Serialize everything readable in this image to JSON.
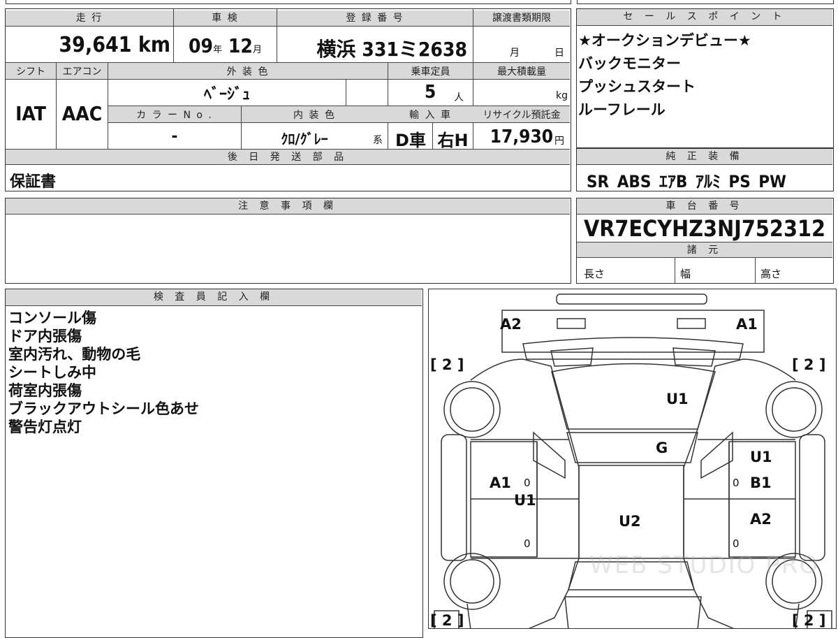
{
  "top_table": {
    "mileage_label": "走 行",
    "mileage_value": "39,641 km",
    "inspection_label": "車 検",
    "inspection_year": "09",
    "inspection_month": "12",
    "unit_year": "年",
    "unit_month": "月",
    "registration_label": "登 録 番 号",
    "registration_value": "横浜 331ミ2638",
    "transfer_label": "譲渡書類期限",
    "transfer_month": "月",
    "transfer_day": "日",
    "shift_label": "シフト",
    "ac_label": "エアコン",
    "ext_color_label": "外 装 色",
    "capacity_label": "乗車定員",
    "max_load_label": "最大積載量",
    "shift_value": "IAT",
    "ac_value": "AAC",
    "ext_color_value": "ﾍﾞｰｼﾞｭ",
    "capacity_value": "5",
    "capacity_unit": "人",
    "load_unit": "kg",
    "color_no_label": "カ ラ ー N o .",
    "int_color_label": "内 装 色",
    "import_label": "輸 入 車",
    "recycle_label": "リサイクル預託金",
    "color_no_value": "-",
    "int_color_value": "ｸﾛ/ｸﾞﾚｰ",
    "int_color_suffix": "系",
    "import_value": "D車",
    "handle_value": "右H",
    "recycle_value": "17,930",
    "recycle_unit": "円",
    "later_parts_label": "後 日 発 送 部 品",
    "later_parts_value": "保証書"
  },
  "sales_points": {
    "label": "セ ー ル ス ポ イ ン ト",
    "items": [
      "★オークションデビュー★",
      "バックモニター",
      "プッシュスタート",
      "ルーフレール"
    ]
  },
  "genuine_equipment": {
    "label": "純 正 装 備",
    "value": "SR ABS ｴｱB ｱﾙﾐ PS PW"
  },
  "notes": {
    "label": "注 意 事 項 欄"
  },
  "chassis": {
    "label": "車 台 番 号",
    "value": "VR7ECYHZ3NJ752312",
    "specs_label": "諸 元",
    "length_label": "長さ",
    "width_label": "幅",
    "height_label": "高さ"
  },
  "inspector": {
    "label": "検 査 員 記 入 欄",
    "items": [
      "コンソール傷",
      "ドア内張傷",
      "室内汚れ、動物の毛",
      "シートしみ中",
      "荷室内張傷",
      "ブラックアウトシール色あせ",
      "警告灯点灯"
    ]
  },
  "diagram": {
    "marks": {
      "a2_top": "A2",
      "a1_top": "A1",
      "u1_hood": "U1",
      "g_windshield": "G",
      "u1_right": "U1",
      "b1_right": "B1",
      "a2_right": "A2",
      "a1_left": "A1",
      "u1_left": "U1",
      "u2_roof": "U2"
    },
    "brackets": {
      "tl": "[ 2 ]",
      "tr": "[ 2 ]",
      "bl": "[ 2 ]",
      "br": "[ 2 ]"
    },
    "zero": "0",
    "watermark": "WEB STUDIO PRO"
  }
}
